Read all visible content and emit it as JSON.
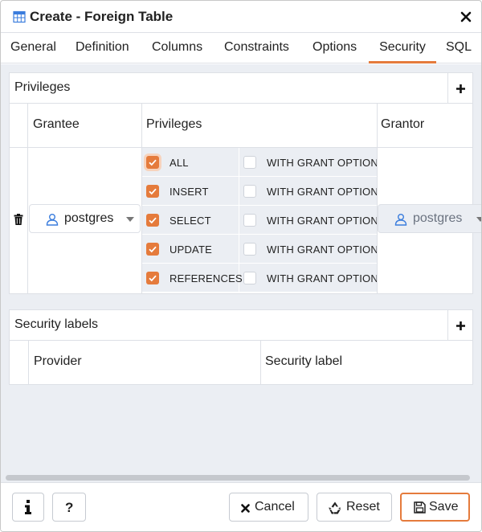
{
  "dialog": {
    "title": "Create - Foreign Table",
    "title_icon": "table-icon",
    "close_icon": "close-icon"
  },
  "tabs": [
    {
      "label": "General",
      "active": false
    },
    {
      "label": "Definition",
      "active": false
    },
    {
      "label": "Columns",
      "active": false
    },
    {
      "label": "Constraints",
      "active": false
    },
    {
      "label": "Options",
      "active": false
    },
    {
      "label": "Security",
      "active": true
    },
    {
      "label": "SQL",
      "active": false
    }
  ],
  "privileges_panel": {
    "title": "Privileges",
    "columns": {
      "grantee": "Grantee",
      "privileges": "Privileges",
      "grantor": "Grantor"
    },
    "row": {
      "grantee": "postgres",
      "grantor": "postgres",
      "privileges": [
        {
          "name": "ALL",
          "checked": true,
          "grant_option_label": "WITH GRANT OPTION",
          "grant_option": false
        },
        {
          "name": "INSERT",
          "checked": true,
          "grant_option_label": "WITH GRANT OPTION",
          "grant_option": false
        },
        {
          "name": "SELECT",
          "checked": true,
          "grant_option_label": "WITH GRANT OPTION",
          "grant_option": false
        },
        {
          "name": "UPDATE",
          "checked": true,
          "grant_option_label": "WITH GRANT OPTION",
          "grant_option": false
        },
        {
          "name": "REFERENCES",
          "checked": true,
          "grant_option_label": "WITH GRANT OPTION",
          "grant_option": false
        }
      ]
    }
  },
  "security_labels_panel": {
    "title": "Security labels",
    "columns": {
      "provider": "Provider",
      "security_label": "Security label"
    }
  },
  "footer": {
    "info_icon": "info-icon",
    "help_label": "?",
    "cancel_label": "Cancel",
    "reset_label": "Reset",
    "save_label": "Save"
  },
  "colors": {
    "accent": "#e57b3c",
    "background": "#ebeef3",
    "border": "#dde0e6",
    "user_icon": "#3b7ddd"
  }
}
